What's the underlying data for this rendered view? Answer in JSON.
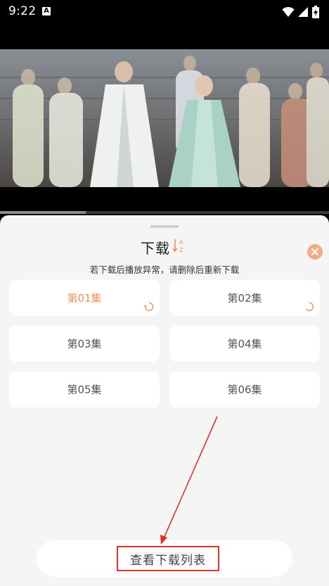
{
  "status_bar": {
    "time": "9:22",
    "notification_icon": "A",
    "icons": [
      "wifi-icon",
      "signal-icon",
      "battery-charging-icon"
    ]
  },
  "video": {
    "progress": 0.26
  },
  "sheet": {
    "title": "下载",
    "sort_icon": "sort-az-icon",
    "close_icon": "close-icon",
    "hint": "若下载后播放异常，请删除后重新下载",
    "episodes": [
      {
        "label": "第01集",
        "state": "downloading"
      },
      {
        "label": "第02集",
        "state": "pending"
      },
      {
        "label": "第03集",
        "state": "none"
      },
      {
        "label": "第04集",
        "state": "none"
      },
      {
        "label": "第05集",
        "state": "none"
      },
      {
        "label": "第06集",
        "state": "none"
      }
    ],
    "view_list_label": "查看下载列表"
  },
  "colors": {
    "accent": "#f0915f",
    "close_bg": "#f4a98a",
    "annotation": "#e0322a"
  }
}
